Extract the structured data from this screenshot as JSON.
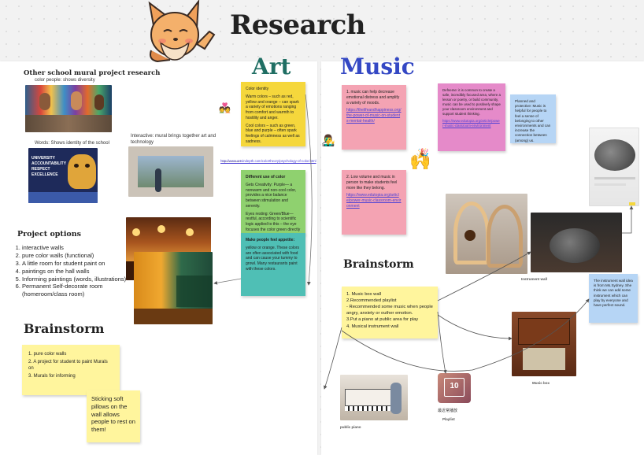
{
  "header": {
    "title": "Research"
  },
  "art": {
    "title": "Art",
    "mural_heading": "Other school mural project research",
    "caption_diversity": "color people: shows diversity",
    "caption_identity": "Words: Shows identity of the school",
    "caption_interactive": "Interactive: mural brings together art and technology",
    "identity_sign_text": "UNIVERSITY ACCOUNTABILITY RESPECT EXCELLENCE",
    "url": "http://www.artsindepth.com/colortheory/psychology-of-color.html",
    "note_color_identity": {
      "title": "Color identity",
      "p1": "Warm colors – such as red, yellow and orange – can spark a variety of emotions ranging from comfort and warmth to hostility and anger.",
      "p2": "Cool colors – such as green, blue and purple – often spark feelings of calmness as well as sadness."
    },
    "note_green": {
      "title": "Different use of color",
      "p1": "Gets Creativity: Purple— a nonwarm and non-cool color, provides a nice balance between stimulation and serenity.",
      "p2": "Eyes resting: Green/Blue— restful, according to scientific logic applied to this – the eye focuses the color green directly on the retina. It is said to be less stressful on your eye muscles."
    },
    "note_teal": {
      "title": "Make people feel appetite:",
      "body": "yellow or orange. These colors are often associated with food and can cause your tummy to growl. Many restaurants paint with these colors."
    },
    "project_options": {
      "heading": "Project options",
      "items": [
        "interactive walls",
        "pure color walls (functional)",
        "A little room for student paint on",
        "paintings on the hall walls",
        "Informing paintings (words, illustrations)",
        "Permanent Self-decorate room (homeroom/class room)"
      ]
    },
    "brainstorm": {
      "heading": "Brainstorm",
      "lines": [
        "1. pure color walls",
        "2. A project for student to paint Murals on",
        "3. Murals for informing"
      ],
      "pillow_note": "Sticking soft pillows on the wall allows people to rest on them!"
    }
  },
  "music": {
    "title": "Music",
    "note_pink1": {
      "text": "1. music can help decrease emotional distress and amplify a variety of moods.",
      "link": "https://thelifeandhappiness.org/the-power-of-music-on-students-mental-health/"
    },
    "note_magenta": {
      "text": "Defneme: it is common to create a safe, incredibly focused area, where a lesson or poetry, or build community, music can be used to positively shape your classroom environment and support student thinking.",
      "link": "https://www.edutopia.org/article/power-music-classroom-environment"
    },
    "note_blue": {
      "text": "Planned and protective: Music is helpful for people to feel a sense of belonging to other environments and can increase the connection between (among) us."
    },
    "note_pink2": {
      "text": "2. Low volume and music in person to make students feel more like they belong.",
      "link": "https://www.edutopia.org/article/power-music-classroom-environment"
    },
    "brainstorm": {
      "heading": "Brainstorm",
      "lines": [
        "1. Music box wall",
        "2.Recommended playlist",
        "- Recommended some music when people angry, anxiety or outher emotion.",
        "3.Put a piano at public area for play",
        "4. Musical instrument wall"
      ]
    },
    "note_instrument": {
      "text": "The instrument wall idea is from Ms.Sydney. She think we can add some instrument which can play by everyone and have perfect sound."
    },
    "caption_instrument": "Instrument wall",
    "caption_musicbox": "Music box",
    "caption_piano": "public piano",
    "caption_playlist": "Playlist",
    "playlist_label": "最近常播放",
    "calendar_day": "10"
  },
  "colors": {
    "yellow": "#f5d73c",
    "light_yellow": "#fff59d",
    "green": "#8fd16f",
    "teal": "#4fbfb5",
    "pink": "#f4a3b3",
    "magenta": "#e58ac9",
    "blue": "#b6d5f5",
    "music_title": "#3448c4",
    "art_title": "#1f6e63"
  }
}
